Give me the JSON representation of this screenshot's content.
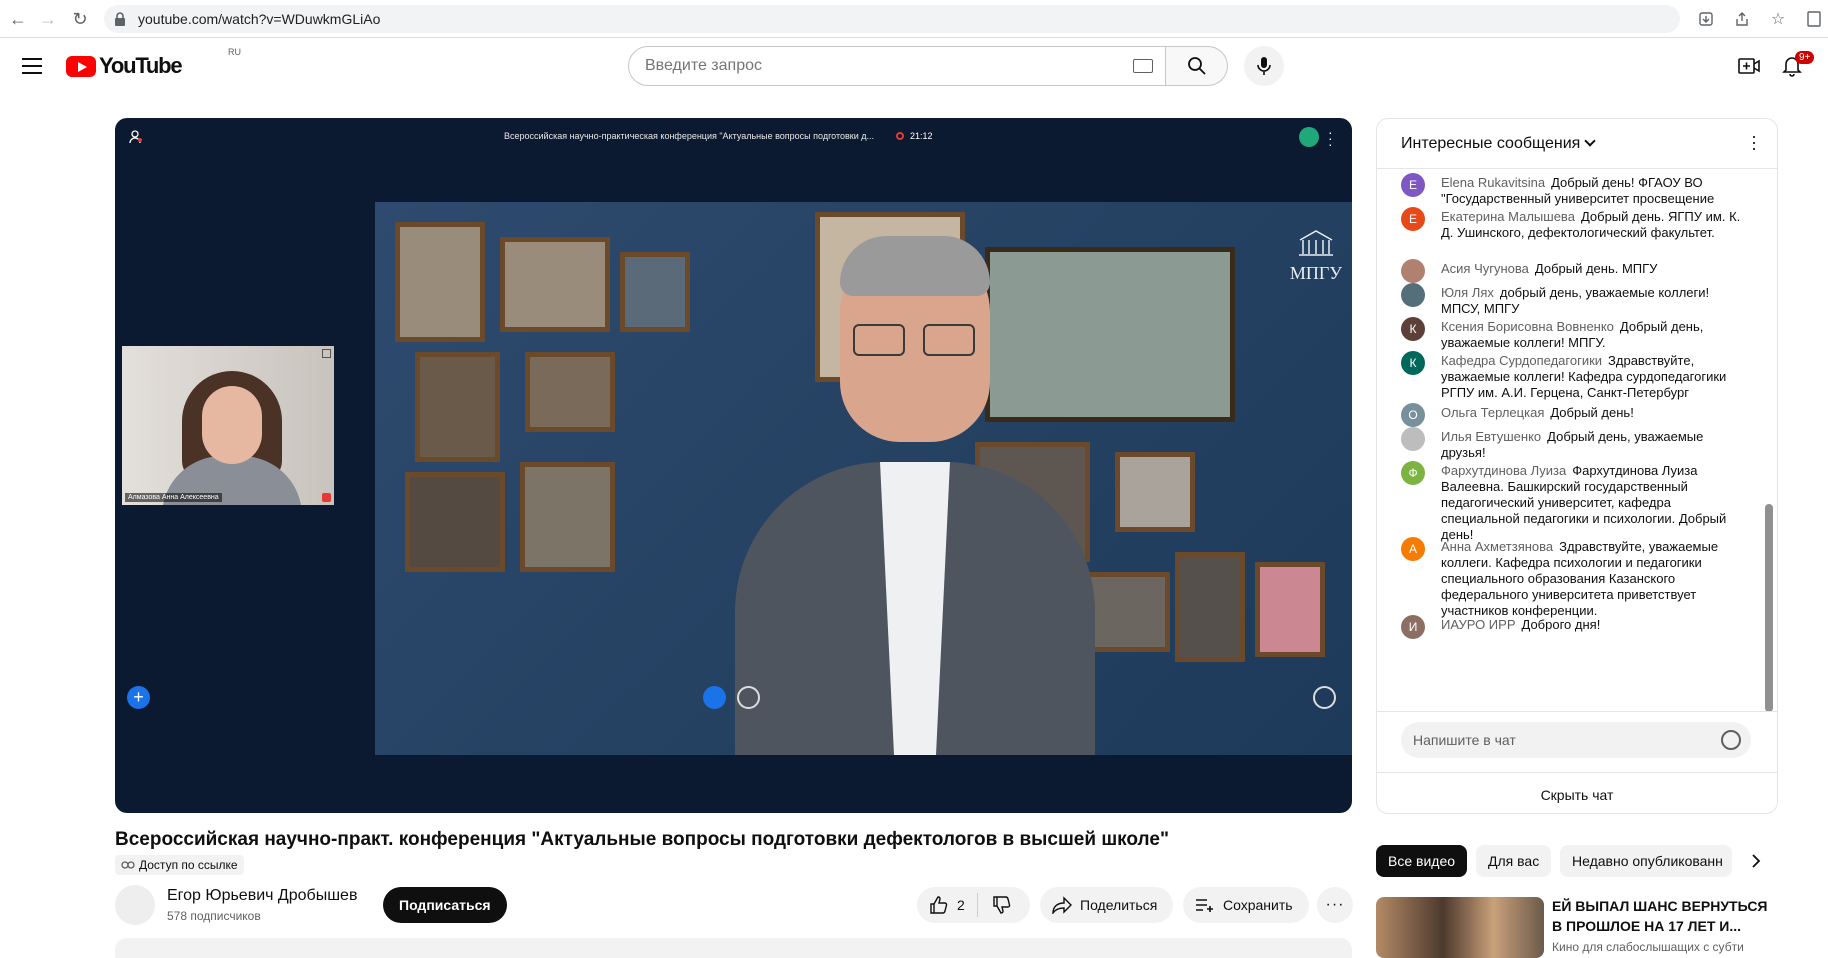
{
  "browser": {
    "url": "youtube.com/watch?v=WDuwkmGLiAo"
  },
  "header": {
    "logo_text": "YouTube",
    "country_code": "RU",
    "search_placeholder": "Введите запрос",
    "notification_count": "9+"
  },
  "player": {
    "meeting_title": "Всероссийская научно-практическая конференция \"Актуальные вопросы подготовки д...",
    "rec_time": "21:12",
    "pip_name": "Алмазова Анна Алексеевна",
    "watermark": "МПГУ"
  },
  "video": {
    "title": "Всероссийская научно-практ. конференция \"Актуальные вопросы подготовки дефектологов в высшей школе\"",
    "access": "Доступ по ссылке",
    "channel_name": "Егор Юрьевич Дробышев",
    "subscribers": "578 подписчиков",
    "subscribe_label": "Подписаться",
    "likes": "2",
    "share_label": "Поделиться",
    "save_label": "Сохранить"
  },
  "chat": {
    "header": "Интересные сообщения",
    "input_placeholder": "Напишите в чат",
    "hide_label": "Скрыть чат",
    "messages": [
      {
        "initial": "E",
        "color": "#7e57c2",
        "author": "Elena Rukavitsina",
        "text": "Добрый день! ФГАОУ ВО \"Государственный университет просвещение"
      },
      {
        "initial": "E",
        "color": "#e64a19",
        "author": "Екатерина Малышева",
        "text": "Добрый день. ЯГПУ им. К. Д. Ушинского, дефектологический факультет."
      },
      {
        "initial": "",
        "color": "#b08070",
        "author": "Асия Чугунова",
        "text": "Добрый день. МПГУ"
      },
      {
        "initial": "",
        "color": "#546e7a",
        "author": "Юля Лях",
        "text": "добрый день, уважаемые коллеги! МПСУ, МПГУ"
      },
      {
        "initial": "К",
        "color": "#5d4037",
        "author": "Ксения Борисовна Вовненко",
        "text": "Добрый день, уважаемые коллеги! МПГУ."
      },
      {
        "initial": "К",
        "color": "#00695c",
        "author": "Кафедра Сурдопедагогики",
        "text": "Здравствуйте, уважаемые коллеги! Кафедра сурдопедагогики РГПУ им. А.И. Герцена, Санкт-Петербург"
      },
      {
        "initial": "О",
        "color": "#78909c",
        "author": "Ольга Терлецкая",
        "text": "Добрый день!"
      },
      {
        "initial": "",
        "color": "#bdbdbd",
        "author": "Илья Евтушенко",
        "text": "Добрый день, уважаемые друзья!"
      },
      {
        "initial": "Ф",
        "color": "#7cb342",
        "author": "Фархутдинова Луиза",
        "text": "Фархутдинова Луиза Валеевна. Башкирский государственный педагогический университет, кафедра специальной педагогики и психологии. Добрый день!"
      },
      {
        "initial": "А",
        "color": "#f57c00",
        "author": "Анна Ахметзянова",
        "text": "Здравствуйте, уважаемые коллеги. Кафедра психологии и педагогики специального образования Казанского федерального университета приветствует участников конференции."
      },
      {
        "initial": "И",
        "color": "#8d6e63",
        "author": "ИАУРО ИРР",
        "text": "Доброго дня!"
      }
    ]
  },
  "chips": {
    "all": "Все видео",
    "for_you": "Для вас",
    "recent": "Недавно опубликованн"
  },
  "recommendation": {
    "title": "ЕЙ ВЫПАЛ ШАНС ВЕРНУТЬСЯ В ПРОШЛОЕ НА 17 ЛЕТ И...",
    "subtitle": "Кино для слабослышащих с субти"
  }
}
